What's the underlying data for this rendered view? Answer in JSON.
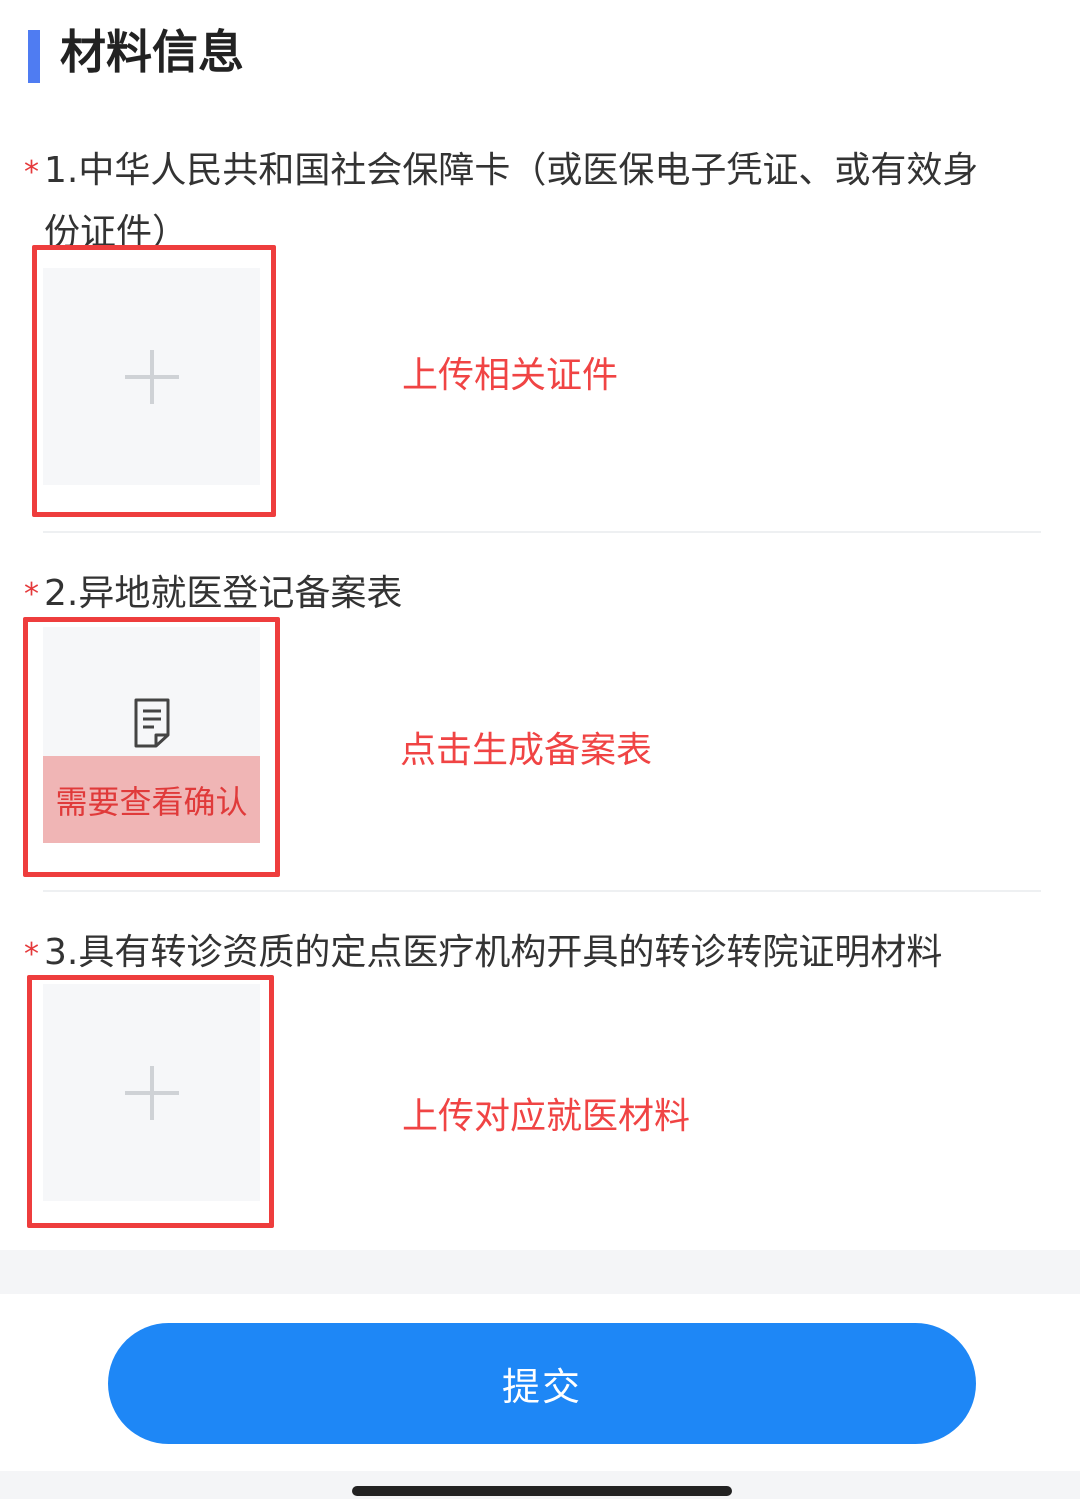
{
  "section": {
    "title": "材料信息"
  },
  "items": [
    {
      "required_mark": "*",
      "label_line1": "1.中华人民共和国社会保障卡（或医保电子凭证、或有效身",
      "label_line2": "份证件）",
      "annotation": "上传相关证件",
      "icon": "plus-icon"
    },
    {
      "required_mark": "*",
      "label_line1": "2.异地就医登记备案表",
      "annotation": "点击生成备案表",
      "confirm_text": "需要查看确认",
      "icon": "document-icon"
    },
    {
      "required_mark": "*",
      "label_line1": "3.具有转诊资质的定点医疗机构开具的转诊转院证明材料",
      "annotation": "上传对应就医材料",
      "icon": "plus-icon"
    }
  ],
  "footer": {
    "submit_label": "提交"
  },
  "colors": {
    "accent_bar": "#4f7cf2",
    "required": "#e5393b",
    "annotation": "#f04444",
    "button": "#1e87f6"
  }
}
